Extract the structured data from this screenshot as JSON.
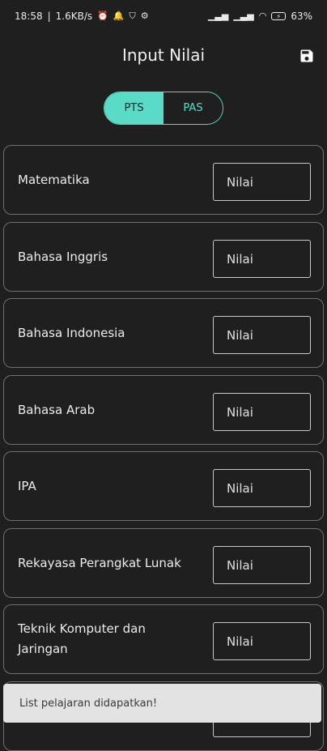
{
  "status_bar": {
    "time": "18:58",
    "speed": "1.6KB/s",
    "battery": "63%"
  },
  "app_bar": {
    "title": "Input Nilai",
    "icon": "save-icon"
  },
  "tabs": [
    {
      "label": "PTS",
      "selected": true
    },
    {
      "label": "PAS",
      "selected": false
    }
  ],
  "subjects": [
    {
      "name": "Matematika",
      "placeholder": "Nilai"
    },
    {
      "name": "Bahasa Inggris",
      "placeholder": "Nilai"
    },
    {
      "name": "Bahasa Indonesia",
      "placeholder": "Nilai"
    },
    {
      "name": "Bahasa Arab",
      "placeholder": "Nilai"
    },
    {
      "name": "IPA",
      "placeholder": "Nilai"
    },
    {
      "name": "Rekayasa Perangkat Lunak",
      "placeholder": "Nilai"
    },
    {
      "name": "Teknik Komputer dan Jaringan",
      "placeholder": "Nilai"
    },
    {
      "name": "",
      "placeholder": "Nilai"
    }
  ],
  "toast": {
    "message": "List pelajaran didapatkan!"
  },
  "colors": {
    "background": "#1f1f1f",
    "accent": "#59dbc7",
    "toast_bg": "#e3e3e3"
  }
}
